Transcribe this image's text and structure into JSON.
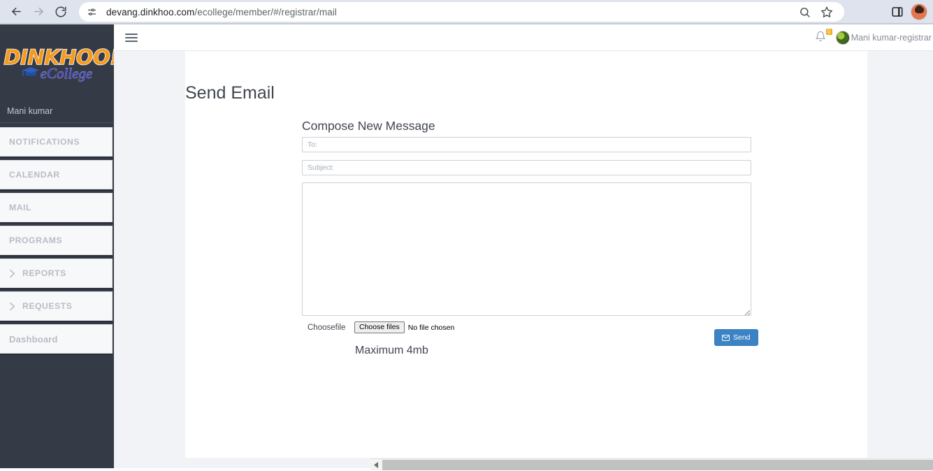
{
  "browser": {
    "url_bold": "devang.dinkhoo.com",
    "url_rest": "/ecollege/member/#/registrar/mail",
    "back_icon": "back-arrow-icon",
    "forward_icon": "forward-arrow-icon",
    "reload_icon": "reload-icon",
    "site_info_icon": "site-settings-icon",
    "zoom_icon": "search-icon",
    "bookmark_icon": "star-icon",
    "side_panel_icon": "side-panel-icon",
    "profile_icon": "profile-avatar"
  },
  "sidebar": {
    "logo_main": "DINKHOO!",
    "logo_sub": "eCollege",
    "logo_cap_icon": "graduation-cap-icon",
    "user": "Mani kumar",
    "items": [
      {
        "label": "NOTIFICATIONS",
        "icon": null
      },
      {
        "label": "CALENDAR",
        "icon": null
      },
      {
        "label": "MAIL",
        "icon": null
      },
      {
        "label": "PROGRAMS",
        "icon": null
      },
      {
        "label": "REPORTS",
        "icon": "chevron-right-icon"
      },
      {
        "label": "REQUESTS",
        "icon": "chevron-right-icon"
      },
      {
        "label": "Dashboard",
        "icon": null
      }
    ]
  },
  "header": {
    "menu_icon": "hamburger-icon",
    "bell_icon": "notification-bell-icon",
    "bell_count": "0",
    "user_name": "Mani kumar-registrar",
    "user_avatar_icon": "user-avatar"
  },
  "main": {
    "page_title": "Send Email",
    "compose_title": "Compose New Message",
    "to_placeholder": "To:",
    "to_value": "",
    "subject_placeholder": "Subject:",
    "subject_value": "",
    "body_value": "",
    "body_placeholder": "",
    "file_label": "Choosefile",
    "file_button": "Choose files",
    "file_status": "No file chosen",
    "max_note": "Maximum 4mb",
    "send_label": "Send",
    "send_icon": "envelope-icon",
    "send_color": "#3c82c4"
  },
  "scrollbar": {
    "left_arrow_icon": "scroll-left-arrow-icon",
    "right_arrow_icon": "scroll-right-arrow-icon"
  }
}
